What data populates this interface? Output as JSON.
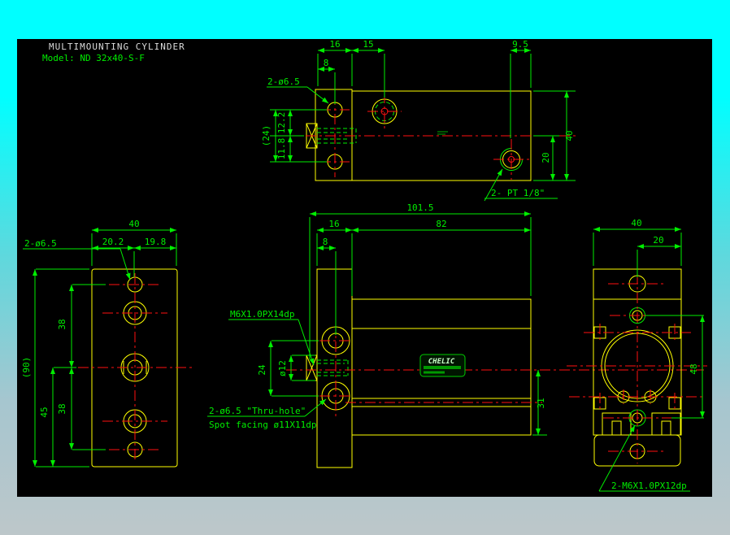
{
  "colors": {
    "desktop_top": "#00ffff",
    "desktop_bottom": "#bdc7ca",
    "canvas": "#000000",
    "object_lines": "#ffff00",
    "dimension_lines": "#00ee00",
    "center_lines": "#ff1010",
    "title_text": "#dcdcdc"
  },
  "drawing": {
    "title": "MULTIMOUNTING CYLINDER",
    "model": "Model: ND 32x40-S-F",
    "logo": "CHELIC",
    "top_view": {
      "w16": "16",
      "w15": "15",
      "w8": "8",
      "w95": "9.5",
      "holes": "2-ø6.5",
      "h24": "(24)",
      "h122": "12.2",
      "h118": "11.8",
      "h40": "40",
      "h20": "20",
      "port": "2- PT 1/8\""
    },
    "left_view": {
      "w40": "40",
      "w202": "20.2",
      "w198": "19.8",
      "holes": "2-ø6.5",
      "d38_upper": "38",
      "d38_lower": "38",
      "d45": "45",
      "d90": "(90)"
    },
    "front_view": {
      "w1015": "101.5",
      "w16": "16",
      "w82": "82",
      "w8": "8",
      "thread": "M6X1.0PX14dp",
      "h24": "24",
      "d12": "ø12",
      "thru_line1": "2-ø6.5 \"Thru-hole\"",
      "thru_line2": "Spot facing ø11X11dp",
      "h31": "31"
    },
    "right_view": {
      "w40": "40",
      "w20": "20",
      "h48": "48",
      "thread": "2-M6X1.0PX12dp"
    }
  }
}
